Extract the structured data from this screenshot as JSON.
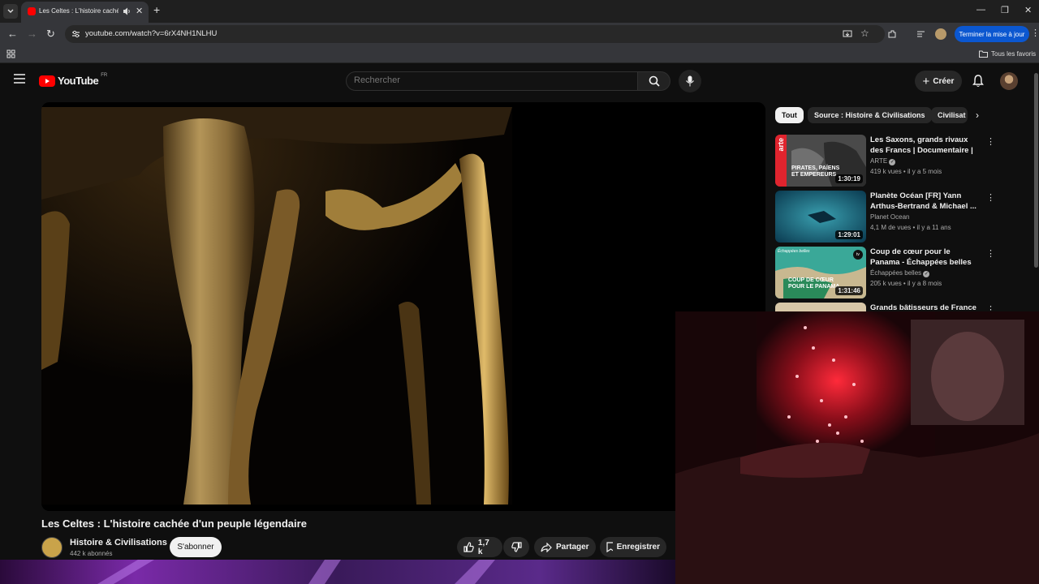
{
  "browser": {
    "tab_title": "Les Celtes : L'histoire cachée",
    "url": "youtube.com/watch?v=6rX4NH1NLHU",
    "update_button": "Terminer la mise à jour",
    "bookmarks_all": "Tous les favoris"
  },
  "youtube": {
    "logo_text": "YouTube",
    "region": "FR",
    "search_placeholder": "Rechercher",
    "create_label": "Créer"
  },
  "video": {
    "title": "Les Celtes : L'histoire cachée d'un peuple légendaire",
    "channel": "Histoire & Civilisations",
    "subscribers": "442 k abonnés",
    "subscribe_label": "S'abonner",
    "likes": "1,7 k",
    "share_label": "Partager",
    "save_label": "Enregistrer"
  },
  "chips": [
    "Tout",
    "Source : Histoire & Civilisations",
    "Civilisat"
  ],
  "recommendations": [
    {
      "title": "Les Saxons, grands rivaux des Francs | Documentaire | ARTE",
      "channel": "ARTE",
      "views": "419 k vues",
      "age": "il y a 5 mois",
      "duration": "1:30:19",
      "verified": true,
      "thumb_text": "PIRATES, PAÏENS ET EMPEREURS",
      "brand": "arte"
    },
    {
      "title": "Planète Océan [FR] Yann Arthus-Bertrand & Michael ...",
      "channel": "Planet Ocean",
      "views": "4,1 M de vues",
      "age": "il y a 11 ans",
      "duration": "1:29:01",
      "verified": false,
      "thumb_text": "",
      "brand": ""
    },
    {
      "title": "Coup de cœur pour le Panama - Échappées belles",
      "channel": "Échappées belles",
      "views": "205 k vues",
      "age": "il y a 8 mois",
      "duration": "1:31:46",
      "verified": true,
      "thumb_text": "COUP DE CŒUR POUR LE PANAMA",
      "brand": "Échappées belles"
    },
    {
      "title": "Grands bâtisseurs de France :",
      "channel": "",
      "views": "",
      "age": "",
      "duration": "",
      "verified": false,
      "thumb_text": "",
      "brand": ""
    }
  ],
  "colors": {
    "accent": "#ff0000",
    "update_blue": "#0b57d0",
    "bg": "#0f0f0f"
  }
}
